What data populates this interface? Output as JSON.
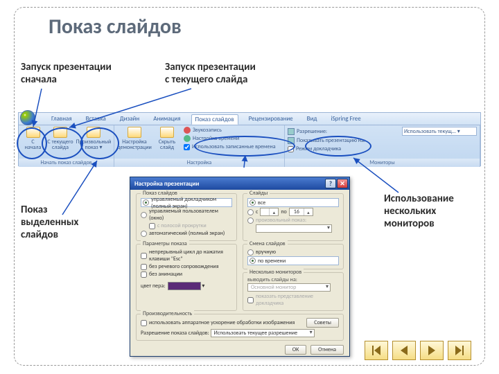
{
  "title": "Показ слайдов",
  "callouts": {
    "c1": "Запуск презентации\nсначала",
    "c2": "Запуск презентации\nс текущего слайда",
    "c3": "Показ\nвыделенных\nслайдов",
    "c4": "Использование\nнескольких\nмониторов"
  },
  "ribbon": {
    "tabs": [
      "Главная",
      "Вставка",
      "Дизайн",
      "Анимация",
      "Показ слайдов",
      "Рецензирование",
      "Вид",
      "iSpring Free"
    ],
    "grp1": {
      "label": "Начать показ слайдов",
      "b1": "С\nначала",
      "b2": "С текущего\nслайда",
      "b3": "Произвольный\nпоказ ▾"
    },
    "grp2": {
      "label": "Настройка",
      "b1": "Настройка\nдемонстрации",
      "b2": "Скрыть\nслайд",
      "c1": "Звукозапись",
      "c2": "Настройка времени",
      "c3": "Использовать записанные времена"
    },
    "grp3": {
      "label": "Мониторы",
      "c1": "Разрешение:",
      "c2": "Показывать презентацию на:",
      "c3": "Режим докладчика",
      "v1": "Использовать текущ... ▾"
    }
  },
  "dialog": {
    "title": "Настройка презентации",
    "show_group": "Показ слайдов",
    "r1": "управляемый докладчиком (полный экран)",
    "r2": "управляемый пользователем (окно)",
    "r2b": "с полосой прокрутки",
    "r3": "автоматический (полный экран)",
    "slides_group": "Слайды",
    "s1": "все",
    "s2_from": "с",
    "s2_to": "по",
    "s2v": "16",
    "s3": "произвольный показ:",
    "opts_group": "Параметры показа",
    "o1": "непрерывный цикл до нажатия клавиши \"Esc\"",
    "o2": "без речевого сопровождения",
    "o3": "без анимации",
    "pen": "цвет пера:",
    "adv_group": "Смена слайдов",
    "a1": "вручную",
    "a2": "по времени",
    "mon_group": "Несколько мониторов",
    "mon_label": "выводить слайды на:",
    "mon_val": "Основной монитор",
    "mon_chk": "показать представление докладчика",
    "perf_group": "Производительность",
    "perf1": "использовать аппаратное ускорение обработки изображения",
    "perf2": "Разрешение показа слайдов:",
    "perf2v": "Использовать текущее разрешение",
    "tips": "Советы",
    "ok": "ОК",
    "cancel": "Отмена"
  }
}
